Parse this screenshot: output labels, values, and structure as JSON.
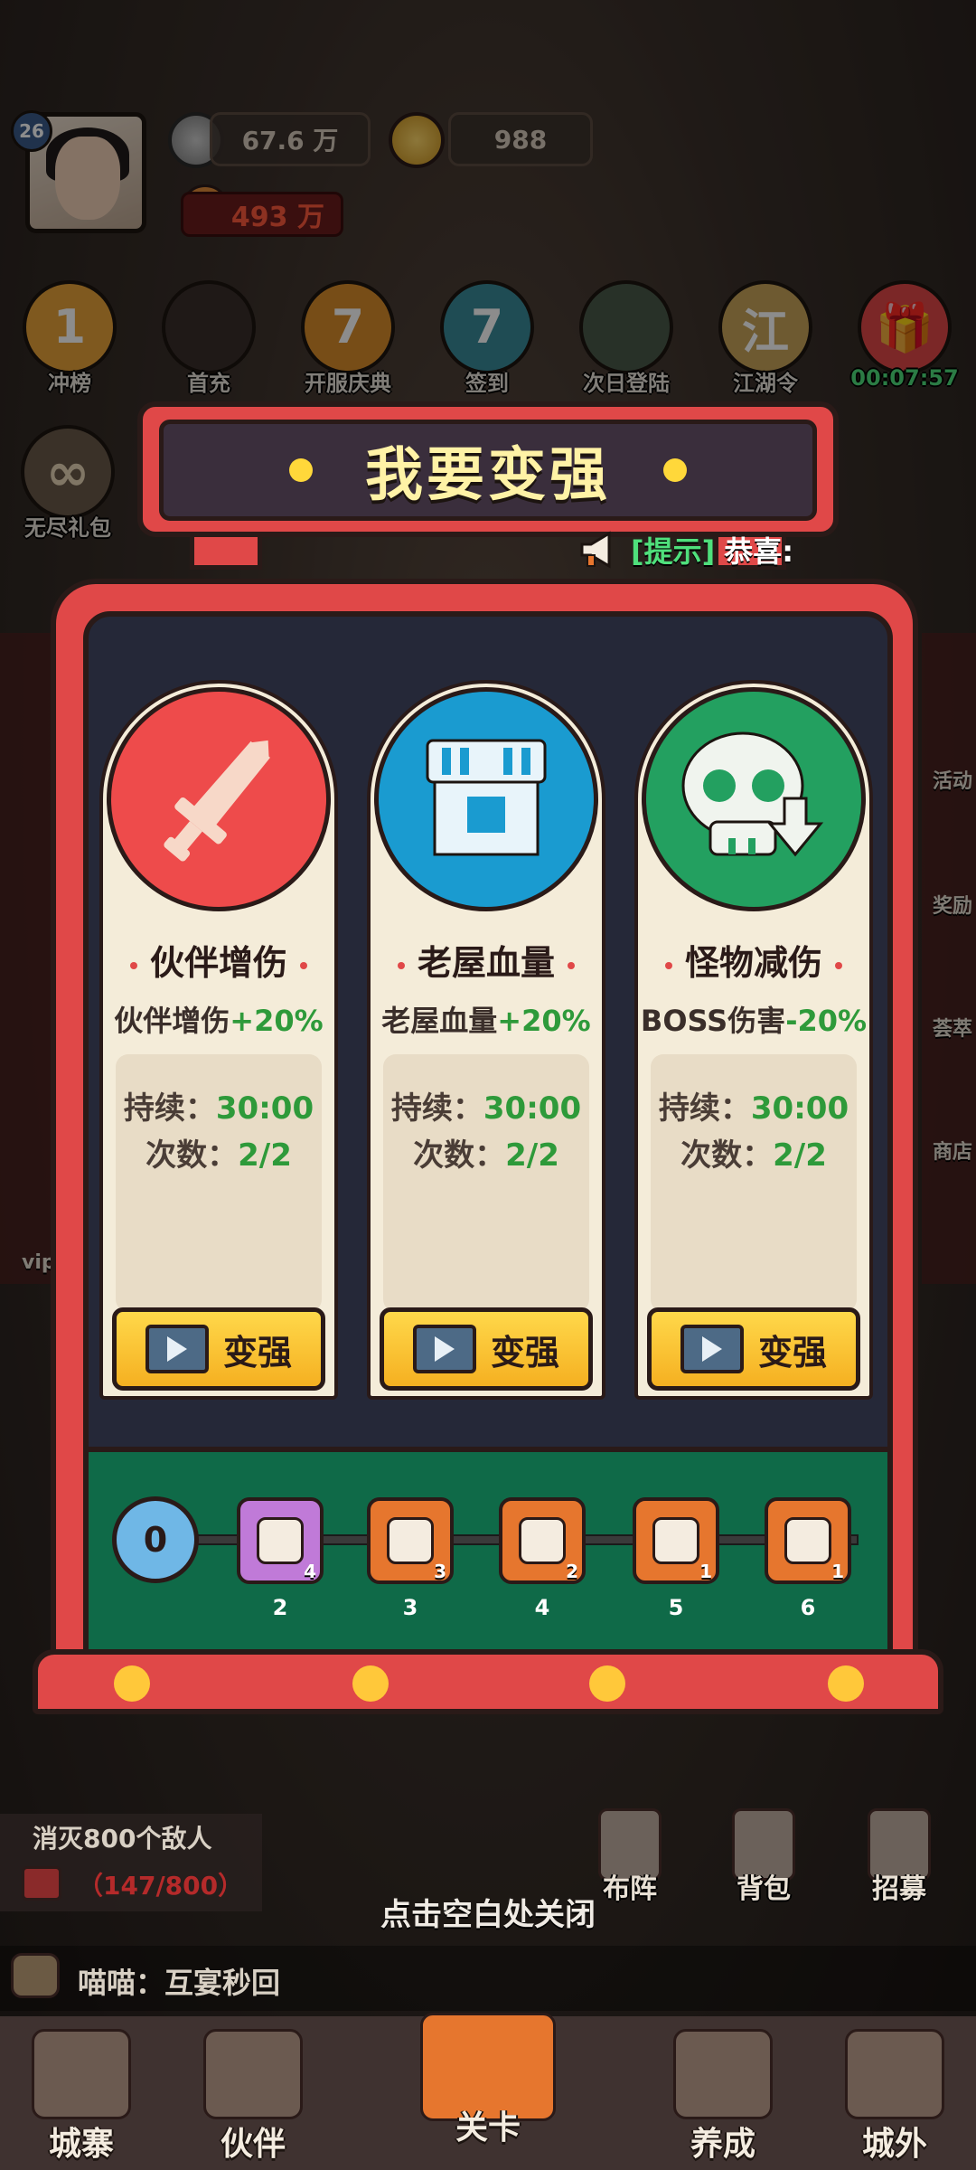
{
  "player": {
    "level": "26",
    "silver": "67.6 万",
    "gold": "988",
    "power": "493 万"
  },
  "events": [
    {
      "label": "冲榜",
      "glyph": "1",
      "color": "#e8a23a"
    },
    {
      "label": "首充",
      "glyph": "",
      "color": "#3a2e2a"
    },
    {
      "label": "开服庆典",
      "glyph": "7",
      "color": "#d98c2a"
    },
    {
      "label": "签到",
      "glyph": "7",
      "color": "#3a8a9a"
    },
    {
      "label": "次日登陆",
      "glyph": "",
      "color": "#4a5a4a"
    },
    {
      "label": "江湖令",
      "glyph": "江",
      "color": "#c9a45a"
    },
    {
      "label": "00:07:57",
      "glyph": "🎁",
      "color": "#e04848"
    }
  ],
  "side_left": {
    "endless_gift": "无尽礼包",
    "vip": "vip"
  },
  "side_right": [
    "活动",
    "奖励",
    "荟萃",
    "商店"
  ],
  "modal": {
    "title": "我要变强",
    "tip_tag": "[提示]",
    "tip_msg": "恭喜:",
    "cards": [
      {
        "title": "伙伴增伤",
        "effect_prefix": "伙伴增伤",
        "effect_value": "+20%",
        "duration_label": "持续：",
        "duration_value": "30:00",
        "count_label": "次数：",
        "count_value": "2/2",
        "button": "变强",
        "icon": "sword-icon",
        "color": "#ee4b4b"
      },
      {
        "title": "老屋血量",
        "effect_prefix": "老屋血量",
        "effect_value": "+20%",
        "duration_label": "持续：",
        "duration_value": "30:00",
        "count_label": "次数：",
        "count_value": "2/2",
        "button": "变强",
        "icon": "house-icon",
        "color": "#1a9bd0"
      },
      {
        "title": "怪物减伤",
        "effect_prefix": "BOSS伤害",
        "effect_value": "-20%",
        "duration_label": "持续：",
        "duration_value": "30:00",
        "count_label": "次数：",
        "count_value": "2/2",
        "button": "变强",
        "icon": "skull-icon",
        "color": "#23a060"
      }
    ],
    "track": {
      "start": "0",
      "items": [
        {
          "step": "2",
          "count": "4",
          "icon": "ticket-icon",
          "color": "#c07ad8"
        },
        {
          "step": "3",
          "count": "3",
          "icon": "diamond-icon",
          "color": "#e6762e"
        },
        {
          "step": "4",
          "count": "2",
          "icon": "card-icon",
          "color": "#e6762e"
        },
        {
          "step": "5",
          "count": "1",
          "icon": "rocket-icon",
          "color": "#e6762e"
        },
        {
          "step": "6",
          "count": "1",
          "icon": "chip-icon",
          "color": "#e6762e"
        }
      ]
    },
    "close_hint": "点击空白处关闭"
  },
  "quest": {
    "title": "消灭800个敌人",
    "progress": "（147/800）"
  },
  "functions": [
    "布阵",
    "背包",
    "招募"
  ],
  "chat": {
    "text": "喵喵：互宴秒回"
  },
  "nav": [
    "城寨",
    "伙伴",
    "关卡",
    "养成",
    "城外"
  ]
}
